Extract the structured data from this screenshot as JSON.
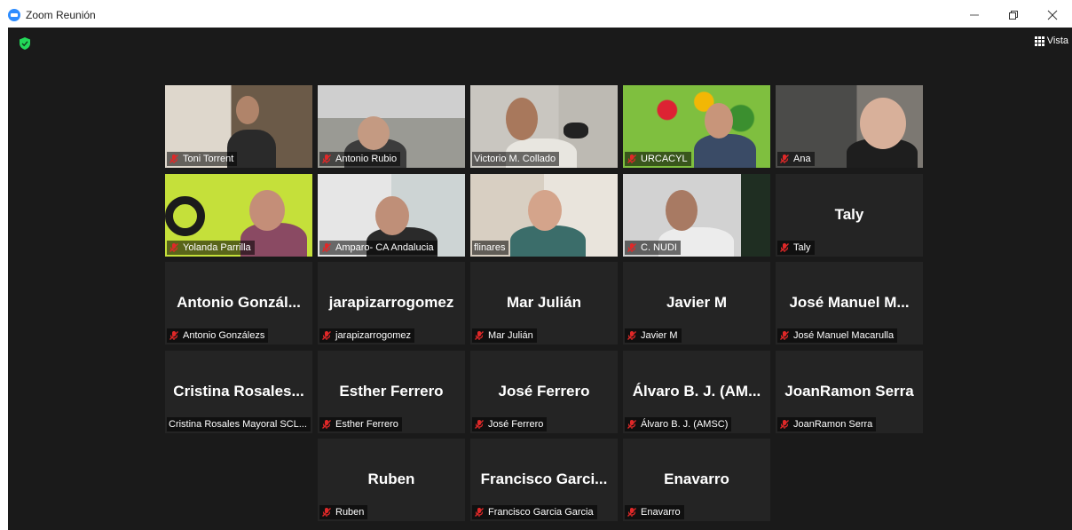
{
  "window": {
    "title": "Zoom Reunión"
  },
  "view_button": {
    "label": "Vista"
  },
  "participants": [
    {
      "display": "",
      "tag": "Toni Torrent",
      "muted": true,
      "video": true
    },
    {
      "display": "",
      "tag": "Antonio Rubio",
      "muted": true,
      "video": true
    },
    {
      "display": "",
      "tag": "Victorio M. Collado",
      "muted": false,
      "video": true,
      "active": true
    },
    {
      "display": "",
      "tag": "URCACYL",
      "muted": true,
      "video": true
    },
    {
      "display": "",
      "tag": "Ana",
      "muted": true,
      "video": true
    },
    {
      "display": "",
      "tag": "Yolanda Parrilla",
      "muted": true,
      "video": true
    },
    {
      "display": "",
      "tag": "Amparo- CA Andalucia",
      "muted": true,
      "video": true
    },
    {
      "display": "",
      "tag": "flinares",
      "muted": false,
      "video": true
    },
    {
      "display": "",
      "tag": "C. NUDI",
      "muted": true,
      "video": true
    },
    {
      "display": "Taly",
      "tag": "Taly",
      "muted": true,
      "video": false
    },
    {
      "display": "Antonio Gonzál...",
      "tag": "Antonio Gonzálezs",
      "muted": true,
      "video": false
    },
    {
      "display": "jarapizarrogomez",
      "tag": "jarapizarrogomez",
      "muted": true,
      "video": false
    },
    {
      "display": "Mar Julián",
      "tag": "Mar Julián",
      "muted": true,
      "video": false
    },
    {
      "display": "Javier M",
      "tag": "Javier M",
      "muted": true,
      "video": false
    },
    {
      "display": "José Manuel M...",
      "tag": "José Manuel Macarulla",
      "muted": true,
      "video": false
    },
    {
      "display": "Cristina Rosales...",
      "tag": "Cristina Rosales Mayoral SCL...",
      "muted": false,
      "video": false
    },
    {
      "display": "Esther Ferrero",
      "tag": "Esther Ferrero",
      "muted": true,
      "video": false
    },
    {
      "display": "José Ferrero",
      "tag": "José Ferrero",
      "muted": true,
      "video": false
    },
    {
      "display": "Álvaro B. J. (AM...",
      "tag": "Álvaro B. J. (AMSC)",
      "muted": true,
      "video": false
    },
    {
      "display": "JoanRamon Serra",
      "tag": "JoanRamon Serra",
      "muted": true,
      "video": false
    },
    {
      "display": "Ruben",
      "tag": "Ruben",
      "muted": true,
      "video": false
    },
    {
      "display": "Francisco Garci...",
      "tag": "Francisco Garcia Garcia",
      "muted": true,
      "video": false
    },
    {
      "display": "Enavarro",
      "tag": "Enavarro",
      "muted": true,
      "video": false
    }
  ],
  "icons": [
    "zoom-logo-icon",
    "shield-check-icon",
    "grid-view-icon",
    "mic-muted-icon",
    "minimize-icon",
    "restore-icon",
    "close-icon"
  ],
  "colors": {
    "active_speaker_border": "#c6e25a",
    "mic_muted": "#e02828",
    "shield": "#23d959",
    "background": "#1a1a1a",
    "tile": "#242424"
  }
}
